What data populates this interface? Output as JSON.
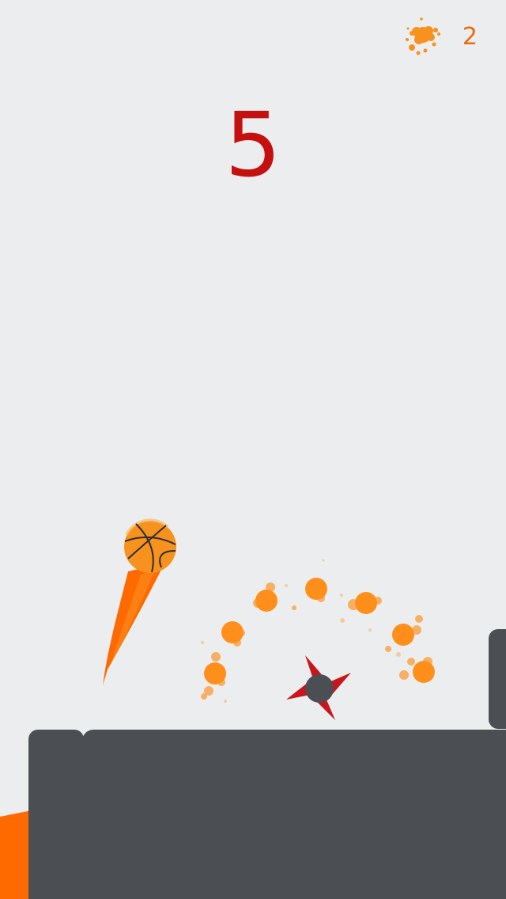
{
  "hud": {
    "score": "5",
    "splat_count": "2"
  },
  "icons": {
    "splat_counter": "orange-splat-icon",
    "ball": "basketball-icon",
    "hazard": "red-shuriken-icon"
  },
  "colors": {
    "background": "#ecedee",
    "score": "#c4110f",
    "ball_orange": "#f7921e",
    "trail_orange": "#ff6a00",
    "particle_orange": "#ff8f1a",
    "platform": "#4b4e52",
    "hazard_red": "#c8161d"
  }
}
